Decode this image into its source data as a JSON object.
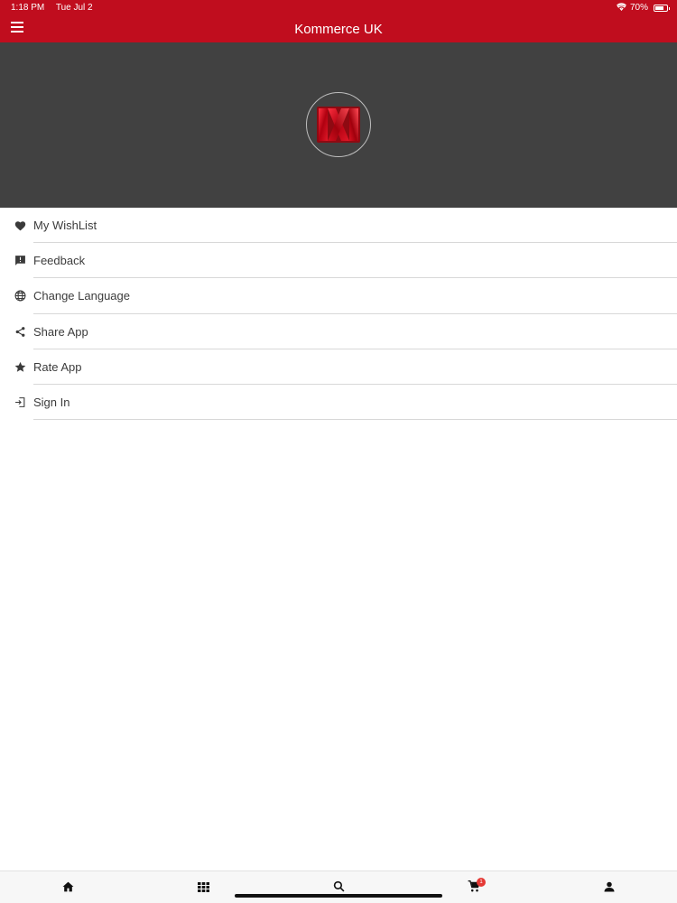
{
  "status_bar": {
    "time": "1:18 PM",
    "date": "Tue Jul 2",
    "battery": "70%",
    "icons": [
      "wifi-icon",
      "battery-icon"
    ]
  },
  "header": {
    "title": "Kommerce UK",
    "menu_icon": "hamburger-icon"
  },
  "colors": {
    "brand": "#c00d1e",
    "hero_bg": "#414141",
    "badge": "#e53935"
  },
  "drawer": {
    "items": [
      {
        "label": "My WishList",
        "icon": "heart-icon"
      },
      {
        "label": "Feedback",
        "icon": "feedback-icon"
      },
      {
        "label": "Change Language",
        "icon": "globe-icon"
      },
      {
        "label": "Share App",
        "icon": "share-icon"
      },
      {
        "label": "Rate App",
        "icon": "star-icon"
      },
      {
        "label": "Sign In",
        "icon": "sign-in-icon"
      }
    ]
  },
  "bottom_nav": {
    "items": [
      "home-icon",
      "grid-icon",
      "search-icon",
      "cart-icon",
      "person-icon"
    ],
    "cart_badge": "1"
  }
}
